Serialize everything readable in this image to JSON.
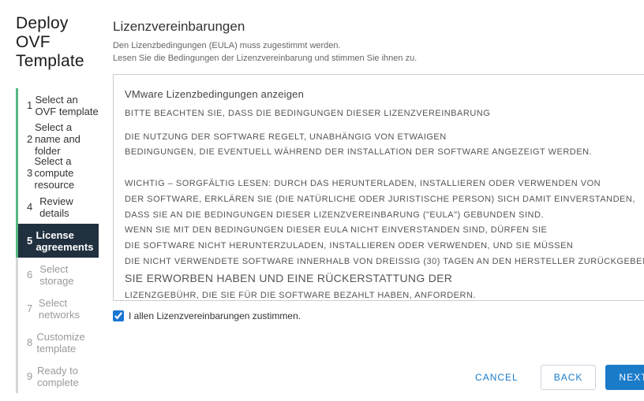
{
  "sidebar": {
    "title": "Deploy OVF Template",
    "steps": [
      {
        "num": "1",
        "label": "Select an OVF template"
      },
      {
        "num": "2",
        "label": "Select a name and folder"
      },
      {
        "num": "3",
        "label": "Select a compute resource"
      },
      {
        "num": "4",
        "label": "Review details"
      },
      {
        "num": "5",
        "label": "License agreements"
      },
      {
        "num": "6",
        "label": "Select storage"
      },
      {
        "num": "7",
        "label": "Select networks"
      },
      {
        "num": "8",
        "label": "Customize template"
      },
      {
        "num": "9",
        "label": "Ready to complete"
      }
    ]
  },
  "main": {
    "title": "Lizenzvereinbarungen",
    "sub1": "Den Lizenzbedingungen (EULA) muss zugestimmt werden.",
    "sub2": "Lesen Sie die Bedingungen der Lizenzvereinbarung und stimmen Sie ihnen zu."
  },
  "eula": {
    "heading": "VMware Lizenzbedingungen anzeigen",
    "l1": "BITTE BEACHTEN SIE, DASS DIE BEDINGUNGEN DIESER LIZENZVEREINBARUNG",
    "l2": "DIE NUTZUNG DER SOFTWARE REGELT, UNABHÄNGIG VON ETWAIGEN",
    "l3": "BEDINGUNGEN, DIE EVENTUELL WÄHREND DER INSTALLATION DER SOFTWARE ANGEZEIGT WERDEN.",
    "l4": "WICHTIG – SORGFÄLTIG LESEN: DURCH DAS HERUNTERLADEN, INSTALLIEREN ODER VERWENDEN VON",
    "l5": "DER SOFTWARE, ERKLÄREN SIE (DIE NATÜRLICHE ODER JURISTISCHE PERSON) SICH DAMIT EINVERSTANDEN,",
    "l6": "DASS SIE AN DIE BEDINGUNGEN DIESER LIZENZVEREINBARUNG (\"EULA\") GEBUNDEN SIND.",
    "l7": "WENN SIE MIT DEN BEDINGUNGEN DIESER EULA NICHT EINVERSTANDEN SIND, DÜRFEN SIE",
    "l8": "DIE SOFTWARE NICHT HERUNTERZULADEN, INSTALLIEREN ODER VERWENDEN, UND SIE MÜSSEN",
    "l9": "DIE NICHT VERWENDETE SOFTWARE INNERHALB VON DREISSIG (30) TAGEN AN DEN HERSTELLER ZURÜCKGEBEN",
    "l10": "SIE ERWORBEN HABEN UND EINE RÜCKERSTATTUNG DER",
    "l11": "LIZENZGEBÜHR, DIE SIE FÜR DIE SOFTWARE BEZAHLT HABEN, ANFORDERN."
  },
  "accept": {
    "label": "I allen Lizenzvereinbarungen zustimmen."
  },
  "buttons": {
    "cancel": "CANCEL",
    "back": "BACK",
    "next": "NEXT"
  }
}
